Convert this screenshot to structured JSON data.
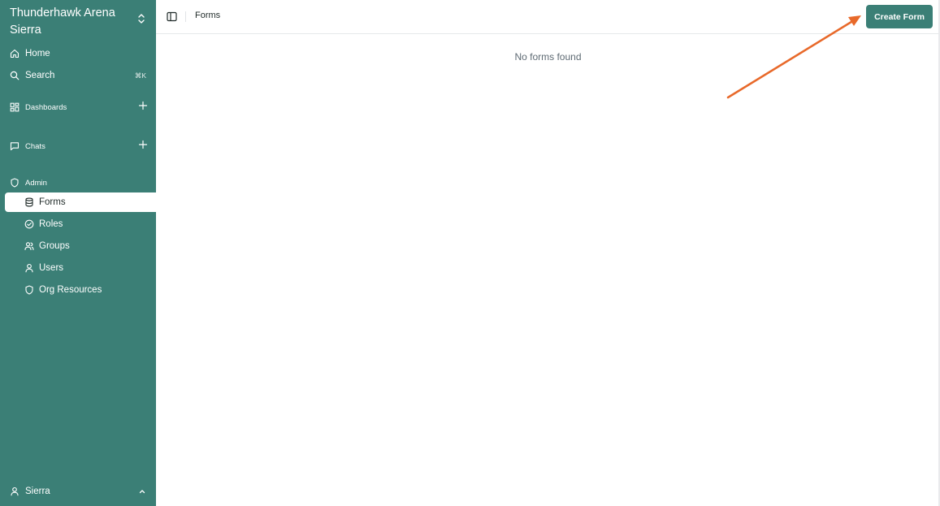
{
  "org": {
    "name": "Thunderhawk Arena Sierra",
    "switch_icon": "chevrons-up-down-icon"
  },
  "nav": {
    "home": {
      "label": "Home",
      "icon": "home-icon"
    },
    "search": {
      "label": "Search",
      "shortcut": "⌘K",
      "icon": "search-icon"
    },
    "dashboards": {
      "label": "Dashboards",
      "icon": "dashboard-grid-icon"
    },
    "chats": {
      "label": "Chats",
      "icon": "chat-bubble-icon"
    },
    "admin": {
      "label": "Admin",
      "icon": "shield-icon"
    },
    "admin_items": [
      {
        "label": "Forms",
        "icon": "database-icon",
        "active": true
      },
      {
        "label": "Roles",
        "icon": "check-circle-icon"
      },
      {
        "label": "Groups",
        "icon": "users-icon"
      },
      {
        "label": "Users",
        "icon": "user-icon"
      },
      {
        "label": "Org Resources",
        "icon": "shield-icon"
      }
    ]
  },
  "user": {
    "name": "Sierra"
  },
  "topbar": {
    "breadcrumb": "Forms",
    "create_label": "Create Form"
  },
  "main": {
    "empty_text": "No forms found"
  },
  "colors": {
    "sidebar": "#3b7f76",
    "accent": "#3b7f76",
    "annotation_arrow": "#e8692a"
  }
}
